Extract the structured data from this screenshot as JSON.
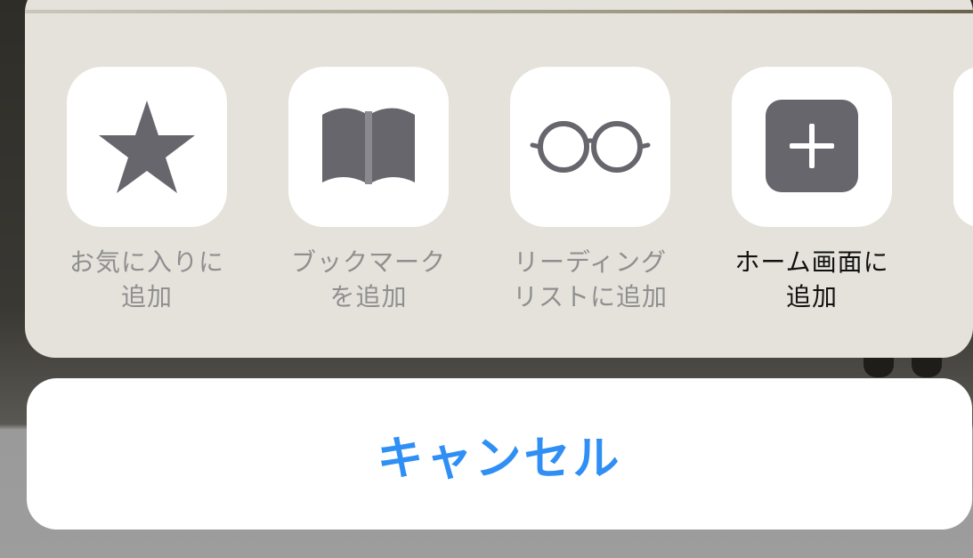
{
  "share_sheet": {
    "actions": [
      {
        "label_line1": "お気に入りに",
        "label_line2": "追加",
        "icon": "star-icon",
        "enabled": false
      },
      {
        "label_line1": "ブックマーク",
        "label_line2": "を追加",
        "icon": "book-icon",
        "enabled": false
      },
      {
        "label_line1": "リーディング",
        "label_line2": "リストに追加",
        "icon": "glasses-icon",
        "enabled": false
      },
      {
        "label_line1": "ホーム画面に",
        "label_line2": "追加",
        "icon": "plus-square-icon",
        "enabled": true
      }
    ]
  },
  "cancel_label": "キャンセル",
  "colors": {
    "accent": "#2f8ff5",
    "icon_gray": "#67666d",
    "disabled_label": "#8f8f91",
    "sheet_bg": "#e4e2da"
  }
}
